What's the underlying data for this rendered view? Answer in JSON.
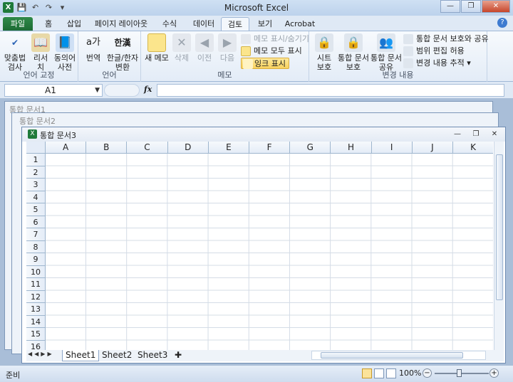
{
  "window": {
    "title": "Microsoft Excel",
    "controls": [
      "minimize-icon",
      "restore-icon",
      "close-icon"
    ]
  },
  "tabs": [
    "파일",
    "홈",
    "삽입",
    "페이지 레이아웃",
    "수식",
    "데이터",
    "검토",
    "보기",
    "Acrobat"
  ],
  "active_tab": "검토",
  "ribbon": {
    "groups": {
      "proofing": "언어 교정",
      "language": "언어",
      "comments": "메모",
      "changes": "변경 내용"
    },
    "proofing": {
      "spell": [
        "맞춤법",
        "검사"
      ],
      "research": "리서치",
      "thesaurus": [
        "동의어",
        "사전"
      ]
    },
    "language": {
      "translate": "번역",
      "hanja": [
        "한글/한자",
        "변환"
      ]
    },
    "comments": {
      "new": "새 메모",
      "delete": "삭제",
      "prev": "이전",
      "next": "다음",
      "show_hide": "메모 표시/숨기기",
      "show_all": "메모 모두 표시",
      "show_ink": "잉크 표시"
    },
    "changes": {
      "protect_sheet": [
        "시트",
        "보호"
      ],
      "protect_workbook": [
        "통합 문서",
        "보호"
      ],
      "share_workbook": [
        "통합 문서",
        "공유"
      ],
      "protect_share": "통합 문서 보호와 공유",
      "allow_ranges": "범위 편집 허용",
      "track_changes": "변경 내용 추적"
    }
  },
  "formula_bar": {
    "name_box": "A1",
    "fx": "fx",
    "formula": ""
  },
  "background_windows": [
    "통합 문서1",
    "통합 문서2"
  ],
  "workbook": {
    "title": "통합 문서3",
    "columns": [
      "A",
      "B",
      "C",
      "D",
      "E",
      "F",
      "G",
      "H",
      "I",
      "J",
      "K"
    ],
    "rows": [
      "1",
      "2",
      "3",
      "4",
      "5",
      "6",
      "7",
      "8",
      "9",
      "10",
      "11",
      "12",
      "13",
      "14",
      "15",
      "16"
    ],
    "sheets": [
      "Sheet1",
      "Sheet2",
      "Sheet3"
    ],
    "active_sheet": "Sheet1"
  },
  "status": {
    "mode": "준비",
    "zoom": "100%"
  }
}
